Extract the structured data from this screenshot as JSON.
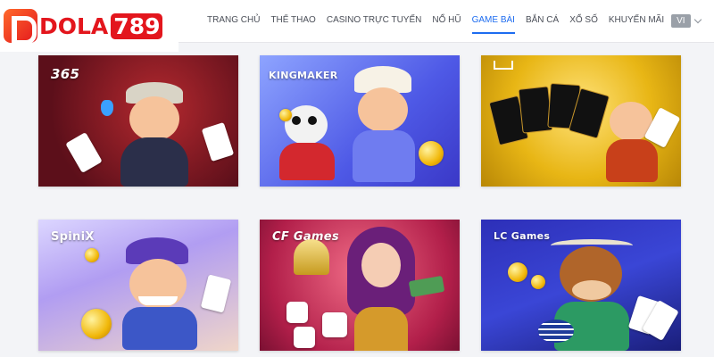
{
  "header": {
    "logo": {
      "text": "DOLA",
      "number": "789"
    },
    "nav": [
      {
        "label": "TRANG CHỦ",
        "active": false
      },
      {
        "label": "THỂ THAO",
        "active": false
      },
      {
        "label": "CASINO TRỰC TUYẾN",
        "active": false
      },
      {
        "label": "NỔ HŨ",
        "active": false
      },
      {
        "label": "GAME BÀI",
        "active": true
      },
      {
        "label": "BẮN CÁ",
        "active": false
      },
      {
        "label": "XỔ SỐ",
        "active": false
      },
      {
        "label": "KHUYẾN MÃI",
        "active": false
      }
    ],
    "language": {
      "value": "VI"
    },
    "colors": {
      "accent": "#1d6cf0",
      "brand": "#e3161d"
    }
  },
  "cards": [
    {
      "provider": "365",
      "theme": "#8c1b24"
    },
    {
      "provider": "KINGMAKER",
      "theme": "#4e59e6"
    },
    {
      "provider": "",
      "theme": "#e8b615"
    },
    {
      "provider": "SpiniX",
      "theme": "#b19df2"
    },
    {
      "provider": "CF Games",
      "theme": "#b21f4a"
    },
    {
      "provider": "LC Games",
      "theme": "#2d2fb8"
    }
  ]
}
